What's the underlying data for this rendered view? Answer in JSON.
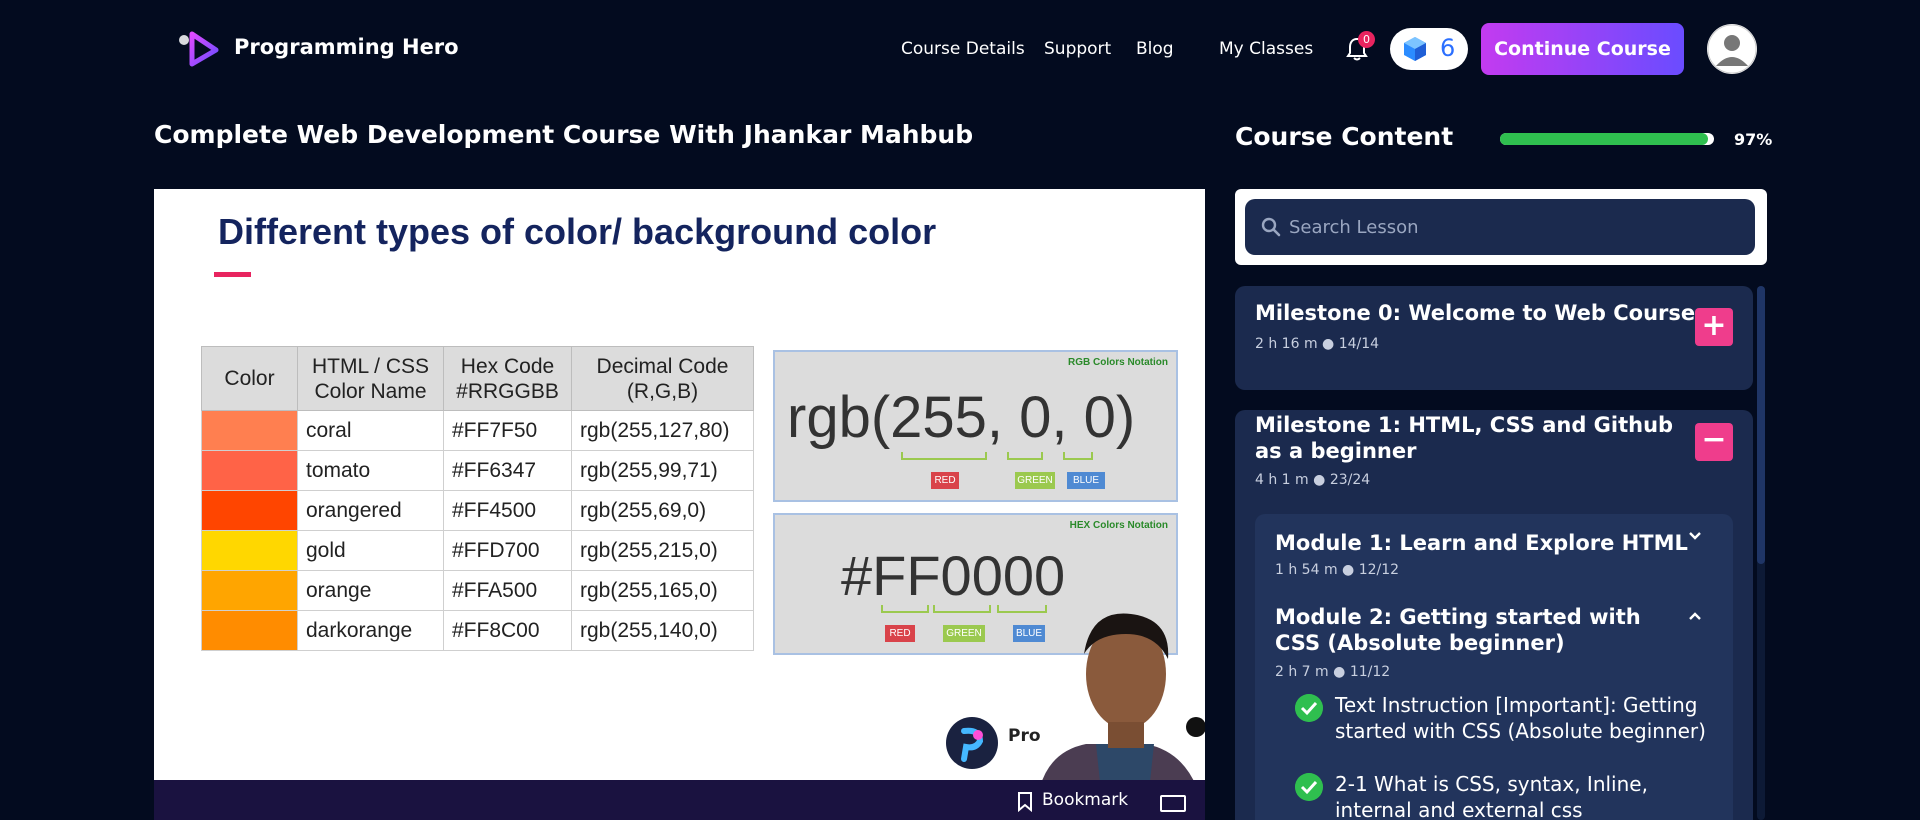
{
  "nav": {
    "brand": "Programming Hero",
    "links": [
      "Course Details",
      "Support",
      "Blog",
      "My Classes"
    ],
    "notification_count": "0",
    "gem_count": "6",
    "continue_label": "Continue Course"
  },
  "course": {
    "title": "Complete Web Development Course With Jhankar Mahbub"
  },
  "slide": {
    "title": "Different types of color/ background color",
    "table": {
      "headers": [
        "Color",
        "HTML / CSS Color Name",
        "Hex Code #RRGGBB",
        "Decimal Code (R,G,B)"
      ],
      "rows": [
        {
          "swatch": "#FF7F50",
          "name": "coral",
          "hex": "#FF7F50",
          "rgb": "rgb(255,127,80)"
        },
        {
          "swatch": "#FF6347",
          "name": "tomato",
          "hex": "#FF6347",
          "rgb": "rgb(255,99,71)"
        },
        {
          "swatch": "#FF4500",
          "name": "orangered",
          "hex": "#FF4500",
          "rgb": "rgb(255,69,0)"
        },
        {
          "swatch": "#FFD700",
          "name": "gold",
          "hex": "#FFD700",
          "rgb": "rgb(255,215,0)"
        },
        {
          "swatch": "#FFA500",
          "name": "orange",
          "hex": "#FFA500",
          "rgb": "rgb(255,165,0)"
        },
        {
          "swatch": "#FF8C00",
          "name": "darkorange",
          "hex": "#FF8C00",
          "rgb": "rgb(255,140,0)"
        }
      ]
    },
    "rgb_notation": {
      "label": "RGB Colors Notation",
      "value": "rgb(255, 0, 0)",
      "tags": [
        "RED",
        "GREEN",
        "BLUE"
      ]
    },
    "hex_notation": {
      "label": "HEX Colors Notation",
      "value": "#FF0000",
      "tags": [
        "RED",
        "GREEN",
        "BLUE"
      ]
    },
    "watermark": "Pro"
  },
  "video_bar": {
    "bookmark_label": "Bookmark"
  },
  "sidebar": {
    "title": "Course Content",
    "progress_percent": 97,
    "progress_label": "97%",
    "search_placeholder": "Search Lesson",
    "milestones": [
      {
        "title": "Milestone 0: Welcome to Web Course",
        "duration": "2 h 16 m",
        "count": "14/14",
        "action": "+"
      },
      {
        "title": "Milestone 1: HTML, CSS and Github as a beginner",
        "duration": "4 h 1 m",
        "count": "23/24",
        "action": "−"
      }
    ],
    "modules": [
      {
        "title": "Module 1: Learn and Explore HTML",
        "duration": "1 h 54 m",
        "count": "12/12"
      },
      {
        "title": "Module 2: Getting started with CSS (Absolute beginner)",
        "duration": "2 h 7 m",
        "count": "11/12"
      }
    ],
    "lessons": [
      "Text Instruction [Important]: Getting started with CSS (Absolute beginner)",
      "2-1 What is CSS, syntax, Inline, internal and external css"
    ]
  },
  "colors": {
    "accent_pink": "#EF3D8C",
    "progress_green": "#2FBF4F",
    "background": "#030B1F",
    "panel": "#1B2A4E"
  }
}
